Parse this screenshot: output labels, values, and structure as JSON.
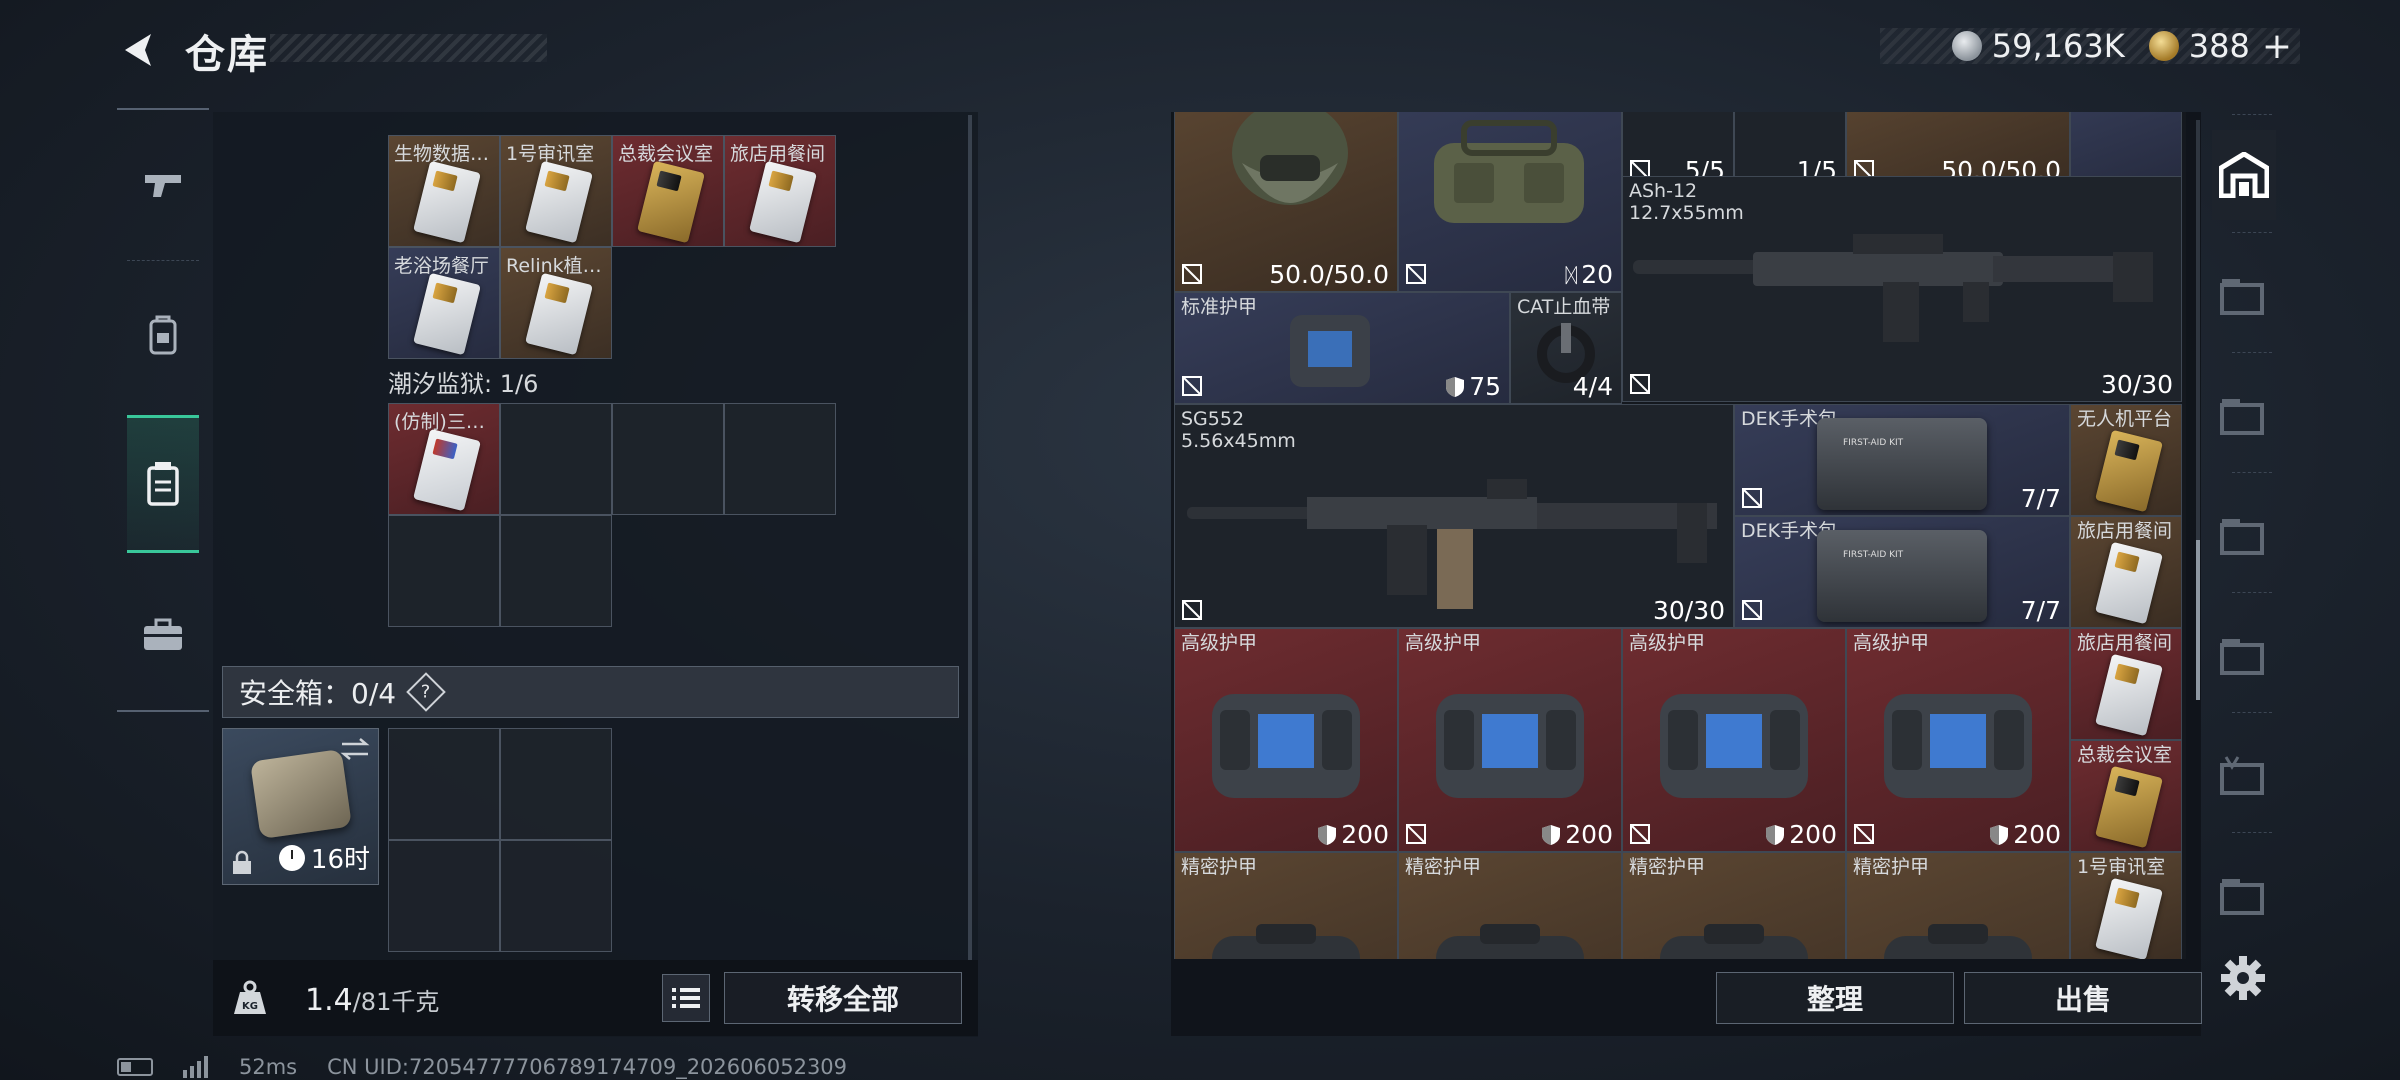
{
  "header": {
    "title": "仓库",
    "currency_silver": "59,163K",
    "currency_gold": "388",
    "currency_add": "+"
  },
  "sidebar": {
    "items": [
      {
        "icon": "pistol-icon"
      },
      {
        "icon": "backpack-icon"
      },
      {
        "icon": "container-icon",
        "active": true
      },
      {
        "icon": "briefcase-icon"
      }
    ]
  },
  "left": {
    "cards_row1": [
      "生物数据…",
      "1号审讯室",
      "总裁会议室",
      "旅店用餐间"
    ],
    "cards_row2": [
      "老浴场餐厅",
      "Relink植…"
    ],
    "section_prison": "潮汐监狱: 1/6",
    "prison_card": "(仿制)三…",
    "safe_label": "安全箱：0/4",
    "safe_help": "?",
    "safe_timer": "16时",
    "weight_value": "1.4",
    "weight_max": "/81千克",
    "transfer_all": "转移全部"
  },
  "right": {
    "top_counts": {
      "a": "5/5",
      "b": "1/5",
      "c": "50.0/50.0"
    },
    "helmet_durability": "50.0/50.0",
    "bag_count": "20",
    "ash12_name": "ASh-12",
    "ash12_caliber": "12.7x55mm",
    "ash12_ammo": "30/30",
    "std_armor_label": "标准护甲",
    "std_armor_value": "75",
    "cat_label": "CAT止血带",
    "cat_count": "4/4",
    "sg552_name": "SG552",
    "sg552_caliber": "5.56x45mm",
    "sg552_ammo": "30/30",
    "dek1_label": "DEK手术包",
    "dek1_count": "7/7",
    "dek2_label": "DEK手术包",
    "dek2_count": "7/7",
    "drone_label": "无人机平台",
    "inn_label_1": "旅店用餐间",
    "inn_label_2": "旅店用餐间",
    "ceo_label": "总裁会议室",
    "interrog_label": "1号审讯室",
    "adv_armor": [
      {
        "label": "高级护甲",
        "value": "200"
      },
      {
        "label": "高级护甲",
        "value": "200"
      },
      {
        "label": "高级护甲",
        "value": "200"
      },
      {
        "label": "高级护甲",
        "value": "200"
      }
    ],
    "precise_armor": [
      "精密护甲",
      "精密护甲",
      "精密护甲",
      "精密护甲"
    ],
    "sort": "整理",
    "sell": "出售"
  },
  "status": {
    "ping": "52ms",
    "uid": "CN UID:72054777706789174709_202606052309"
  },
  "colors": {
    "accent_green": "#39c79a",
    "slot_red": "#6e2c30",
    "slot_brown": "#5b4632",
    "slot_navy": "#363d58"
  }
}
